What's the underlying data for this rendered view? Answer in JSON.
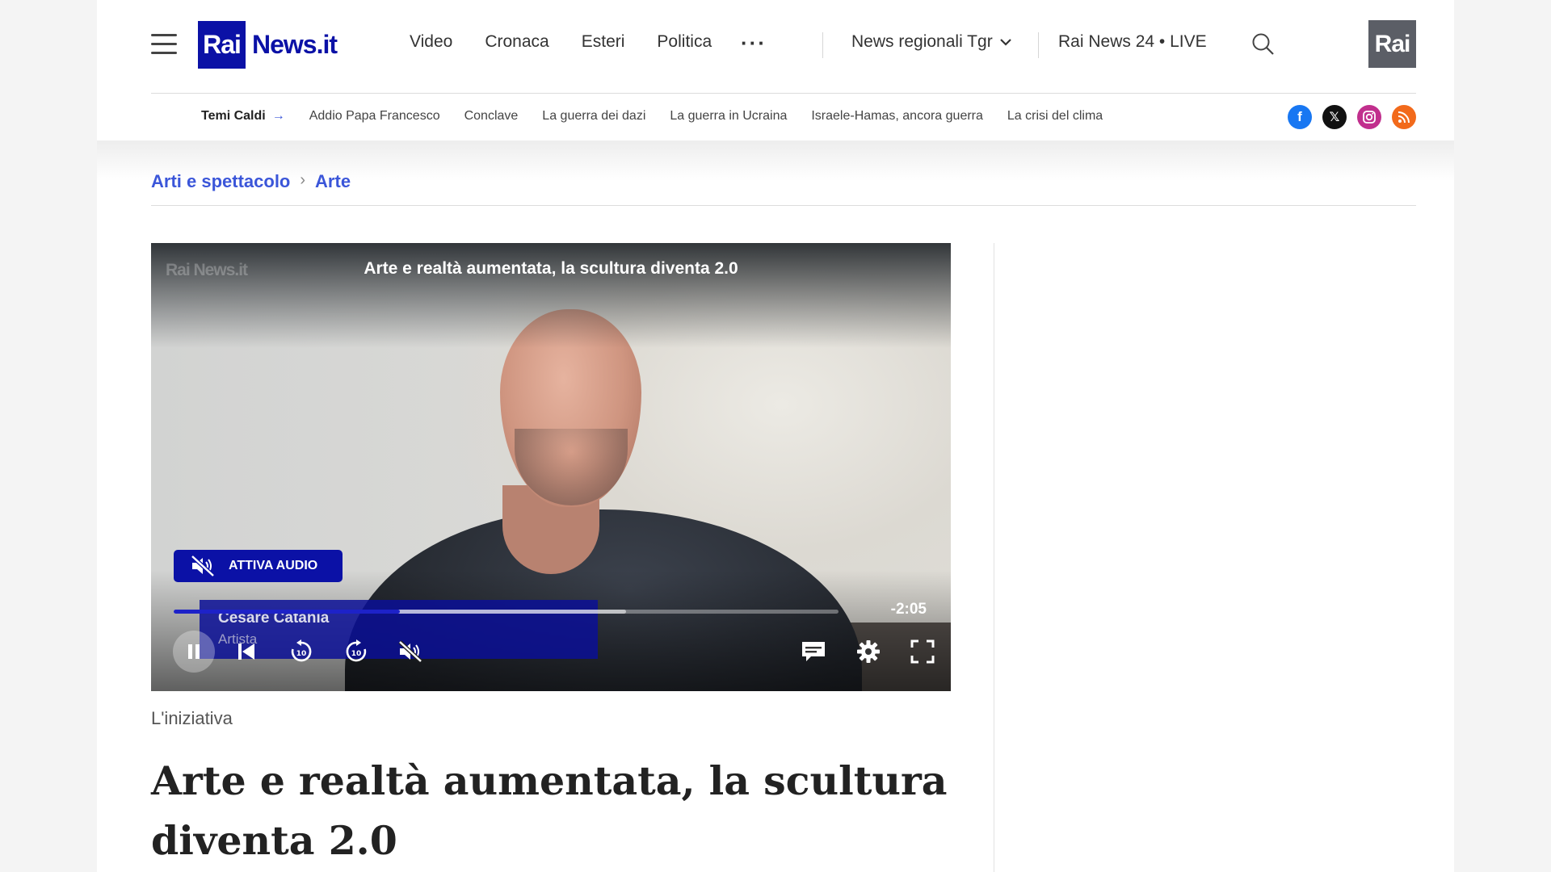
{
  "header": {
    "logo_mark": "Rai",
    "logo_text": "News.it",
    "nav": [
      "Video",
      "Cronaca",
      "Esteri",
      "Politica"
    ],
    "more_label": "···",
    "regional": "News regionali Tgr",
    "live": "Rai News 24 • LIVE",
    "rai_logo": "Rai"
  },
  "topics": {
    "label": "Temi Caldi",
    "items": [
      "Addio Papa Francesco",
      "Conclave",
      "La guerra dei dazi",
      "La guerra in Ucraina",
      "Israele-Hamas, ancora guerra",
      "La crisi del clima"
    ]
  },
  "social": [
    "facebook-icon",
    "x-icon",
    "instagram-icon",
    "rss-icon"
  ],
  "breadcrumb": [
    "Arti e spettacolo",
    "Arte"
  ],
  "video": {
    "watermark": "Rai News.it",
    "title": "Arte e realtà aumentata, la scultura diventa 2.0",
    "audio_button": "ATTIVA AUDIO",
    "lower_third_name": "Cesare Catania",
    "lower_third_role": "Artista",
    "remaining_time": "-2:05",
    "progress_played": 0.34,
    "progress_buffered": 0.68
  },
  "article": {
    "kicker": "L'iniziativa",
    "headline": "Arte e realtà aumentata, la scultura diventa 2.0"
  },
  "colors": {
    "brand": "#0b11a6",
    "link": "#3b56d9"
  }
}
